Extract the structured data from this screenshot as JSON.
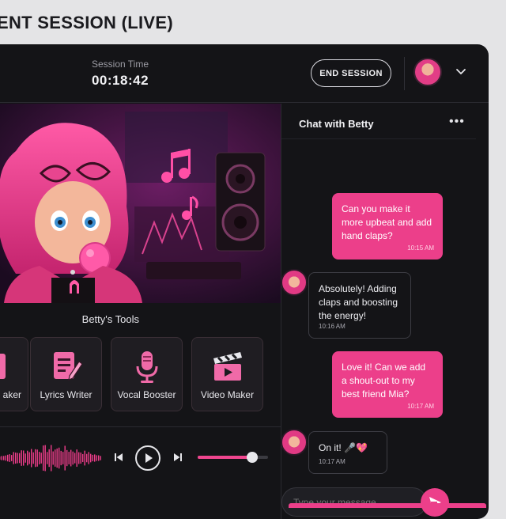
{
  "page": {
    "title": "ENT SESSION (LIVE)"
  },
  "topbar": {
    "session_time_label": "Session Time",
    "session_time": "00:18:42",
    "end_session_label": "END SESSION",
    "avatar_icon": "user-avatar",
    "menu_icon": "chevron-down-icon"
  },
  "tools": {
    "title": "Betty's Tools",
    "items": [
      {
        "label": "aker",
        "icon": "beat-maker-icon"
      },
      {
        "label": "Lyrics Writer",
        "icon": "lyrics-writer-icon"
      },
      {
        "label": "Vocal Booster",
        "icon": "microphone-icon"
      },
      {
        "label": "Video Maker",
        "icon": "clapperboard-icon"
      }
    ]
  },
  "player": {
    "volume_fraction": 0.77,
    "icons": [
      "waveform-icon",
      "previous-icon",
      "play-icon",
      "next-icon",
      "volume-slider"
    ]
  },
  "chat": {
    "title": "Chat with Betty",
    "more_label": "•••",
    "messages": [
      {
        "from": "user",
        "text": "Can you make it more upbeat and add hand claps?",
        "time": "10:15 AM"
      },
      {
        "from": "betty",
        "text": "Absolutely! Adding claps and boosting the energy!",
        "time": "10:16 AM"
      },
      {
        "from": "user",
        "text": "Love it! Can we add a shout-out to my best friend Mia?",
        "time": "10:17 AM"
      },
      {
        "from": "betty",
        "text": "On it! 🎤💖",
        "time": "10:17 AM"
      }
    ],
    "input_placeholder": "Type your message...",
    "send_icon": "send-icon"
  },
  "colors": {
    "accent": "#ec3f8a",
    "panel_bg": "#141417",
    "page_bg": "#e4e4e6"
  }
}
